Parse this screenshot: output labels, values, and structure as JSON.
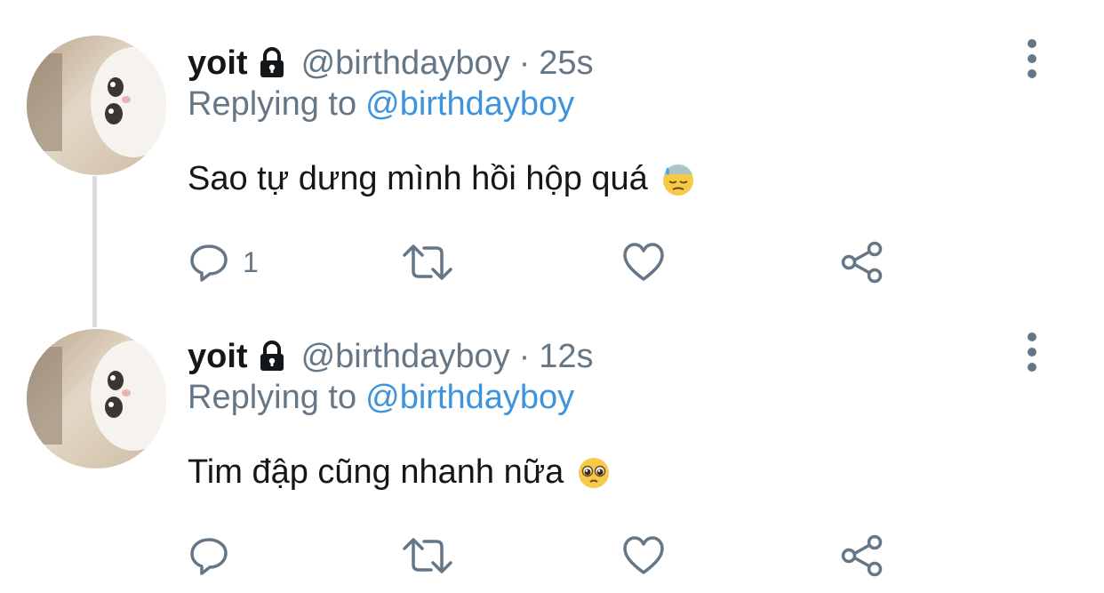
{
  "tweets": [
    {
      "display_name": "yoit",
      "handle": "@birthdayboy",
      "separator": "·",
      "time": "25s",
      "replying_prefix": "Replying to",
      "replying_to": "@birthdayboy",
      "text": "Sao tự dưng mình hồi hộp quá",
      "emoji": "downcast-face-with-sweat-icon",
      "reply_count": "1",
      "retweet_count": "",
      "like_count": ""
    },
    {
      "display_name": "yoit",
      "handle": "@birthdayboy",
      "separator": "·",
      "time": "12s",
      "replying_prefix": "Replying to",
      "replying_to": "@birthdayboy",
      "text": "Tim đập cũng nhanh nữa",
      "emoji": "pleading-face-icon",
      "reply_count": "",
      "retweet_count": "",
      "like_count": ""
    }
  ],
  "colors": {
    "text": "#14171a",
    "muted": "#657786",
    "link": "#3d94dc",
    "thread_line": "#d9dde0"
  }
}
